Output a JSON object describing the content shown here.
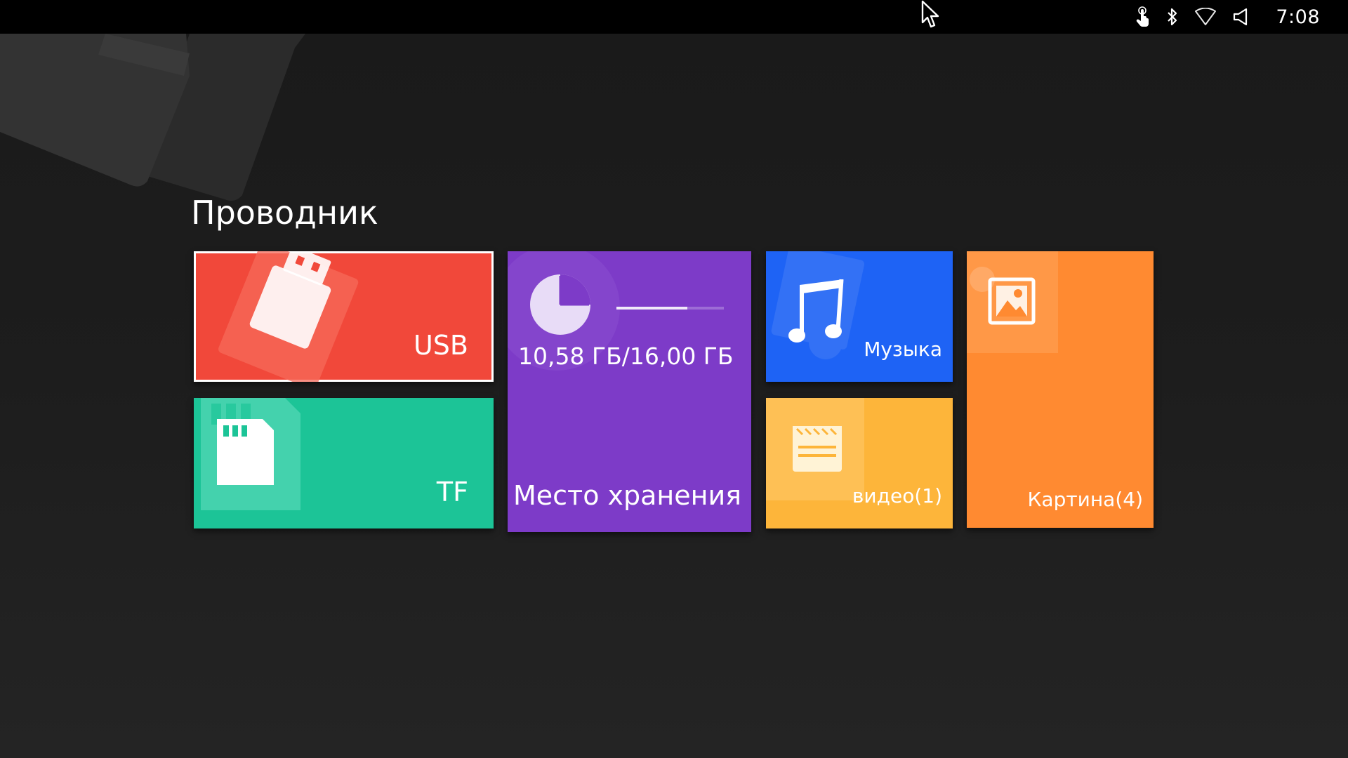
{
  "status_bar": {
    "time": "7:08",
    "icons": [
      "touch-icon",
      "bluetooth-icon",
      "wifi-icon",
      "volume-icon"
    ]
  },
  "page": {
    "title": "Проводник"
  },
  "tiles": {
    "usb": {
      "label": "USB",
      "color": "#f1483a",
      "icon": "usb-drive-icon"
    },
    "tf": {
      "label": "TF",
      "color": "#1cc497",
      "icon": "sd-card-icon"
    },
    "storage": {
      "label": "Место хранения",
      "usage": "10,58 ГБ/16,00 ГБ",
      "used_fraction": 0.66,
      "color": "#7d3bc8",
      "icon": "pie-chart-icon"
    },
    "music": {
      "label": "Музыка",
      "color": "#1e63f5",
      "icon": "music-note-icon"
    },
    "video": {
      "label": "видео(1)",
      "color": "#fdb53a",
      "icon": "clapperboard-icon"
    },
    "picture": {
      "label": "Картина(4)",
      "color": "#ff8a31",
      "icon": "image-icon"
    }
  }
}
